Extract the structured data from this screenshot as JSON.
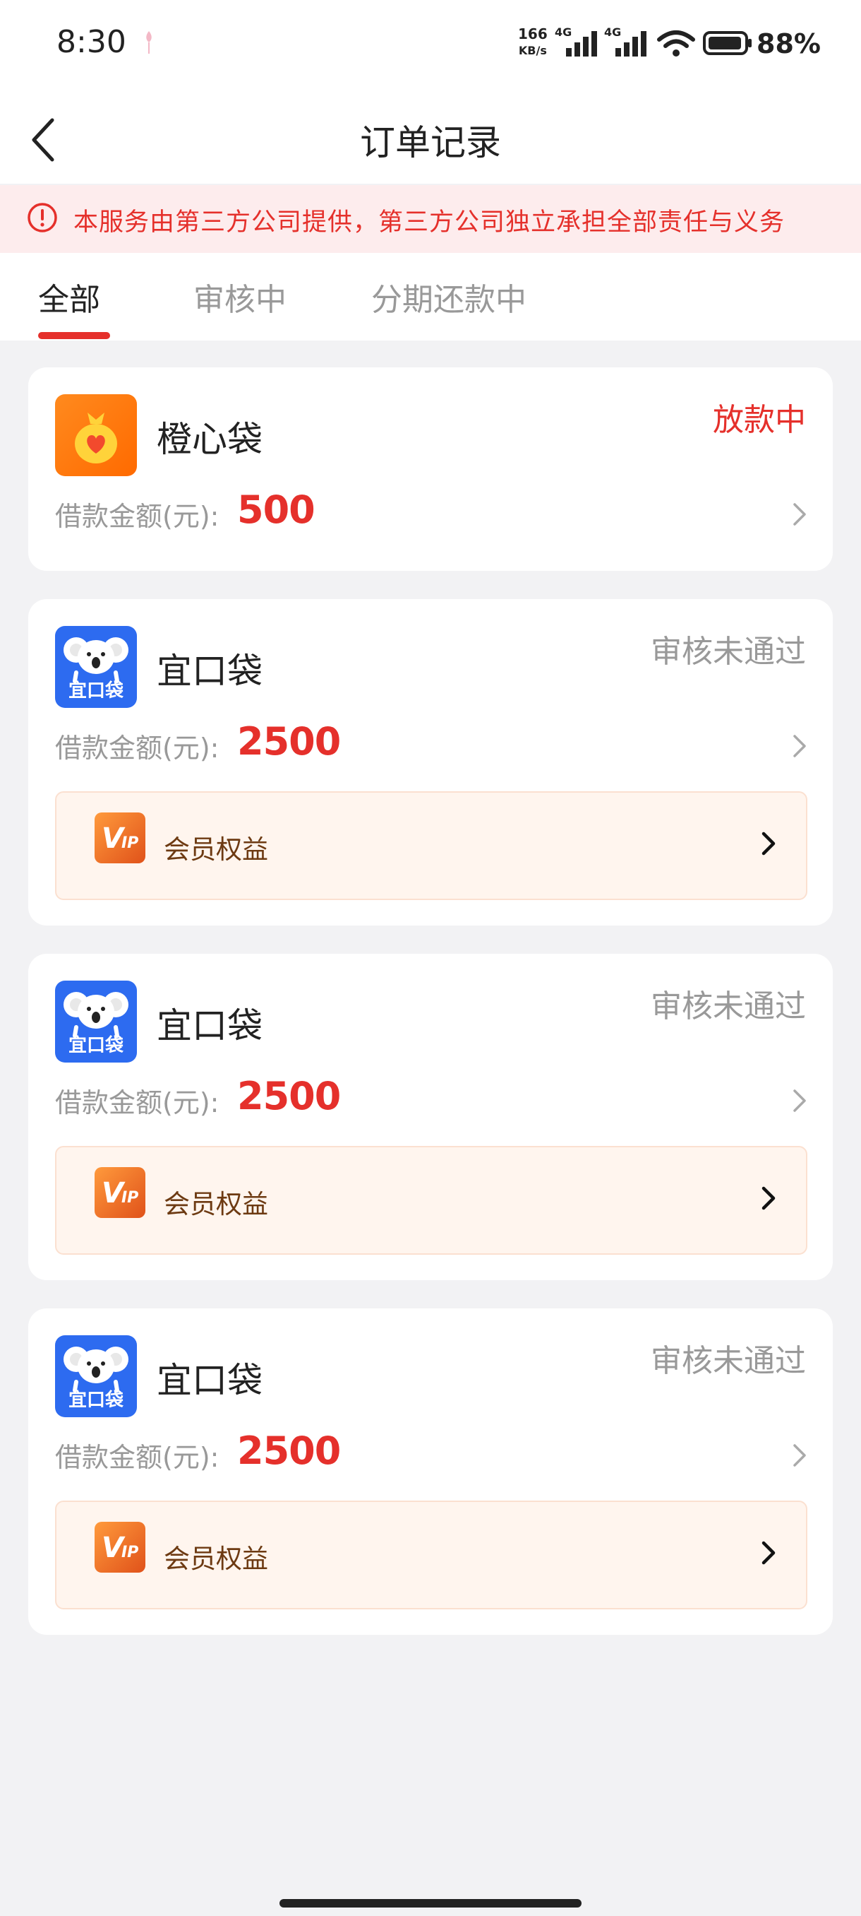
{
  "status_bar": {
    "time": "8:30",
    "speed_value": "166",
    "speed_unit": "KB/s",
    "net1": "4G",
    "net2": "4G",
    "battery": "88%"
  },
  "header": {
    "title": "订单记录",
    "back_icon": "chevron-left-icon"
  },
  "notice": {
    "icon": "alert-circle-icon",
    "text": "本服务由第三方公司提供，第三方公司独立承担全部责任与义务"
  },
  "tabs": [
    {
      "label": "全部",
      "active": true
    },
    {
      "label": "审核中",
      "active": false
    },
    {
      "label": "分期还款中",
      "active": false
    }
  ],
  "orders": [
    {
      "name": "橙心袋",
      "status": "放款中",
      "amount_label": "借款金额(元):",
      "amount": "500",
      "logo": "money-bag-heart-icon",
      "has_vip": false
    },
    {
      "name": "宜口袋",
      "status": "审核未通过",
      "amount_label": "借款金额(元):",
      "amount": "2500",
      "logo": "koala-logo-icon",
      "logo_text": "宜口袋",
      "has_vip": true,
      "vip_label": "会员权益",
      "vip_icon": "vip-badge-icon"
    },
    {
      "name": "宜口袋",
      "status": "审核未通过",
      "amount_label": "借款金额(元):",
      "amount": "2500",
      "logo": "koala-logo-icon",
      "logo_text": "宜口袋",
      "has_vip": true,
      "vip_label": "会员权益",
      "vip_icon": "vip-badge-icon"
    },
    {
      "name": "宜口袋",
      "status": "审核未通过",
      "amount_label": "借款金额(元):",
      "amount": "2500",
      "logo": "koala-logo-icon",
      "logo_text": "宜口袋",
      "has_vip": true,
      "vip_label": "会员权益",
      "vip_icon": "vip-badge-icon"
    }
  ],
  "colors": {
    "accent_red": "#e5302b",
    "notice_bg": "#fdeced",
    "page_bg": "#f2f2f4",
    "vip_bg": "#fff5ee"
  }
}
